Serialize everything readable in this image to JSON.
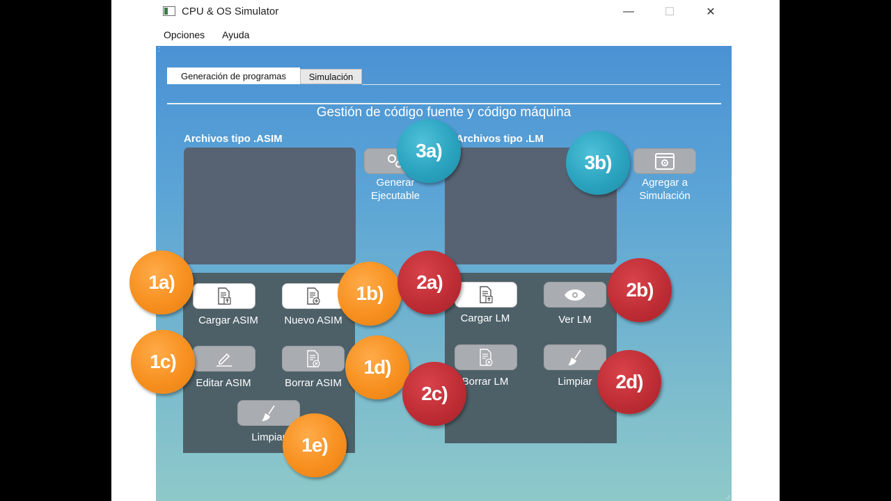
{
  "window": {
    "title": "CPU & OS Simulator",
    "minimize": "—",
    "maximize": "☐",
    "close": "✕"
  },
  "menu": [
    {
      "label": "Opciones"
    },
    {
      "label": "Ayuda"
    }
  ],
  "tabs": [
    {
      "label": "Generación de programas",
      "active": true
    },
    {
      "label": "Simulación",
      "active": false
    }
  ],
  "main": {
    "section_title": "Gestión de código fuente y código máquina",
    "asim": {
      "header": "Archivos tipo .ASIM",
      "buttons": {
        "load": "Cargar ASIM",
        "new": "Nuevo ASIM",
        "edit": "Editar ASIM",
        "delete": "Borrar ASIM",
        "clear": "Limpiar"
      }
    },
    "generate": "Generar Ejecutable",
    "lm": {
      "header": "Archivos tipo .LM",
      "buttons": {
        "load": "Cargar LM",
        "view": "Ver LM",
        "delete": "Borrar LM",
        "clear": "Limpiar"
      }
    },
    "add_simulation": "Agregar a Simulación"
  },
  "annotations": [
    "1a)",
    "1b)",
    "1c)",
    "1d)",
    "1e)",
    "2a)",
    "2b)",
    "2c)",
    "2d)",
    "3a)",
    "3b)"
  ],
  "colors": {
    "orange": "#f7901f",
    "red": "#bf2d35",
    "teal": "#2aa3bf",
    "listbox": "#576373",
    "panel": "#4d6068"
  }
}
